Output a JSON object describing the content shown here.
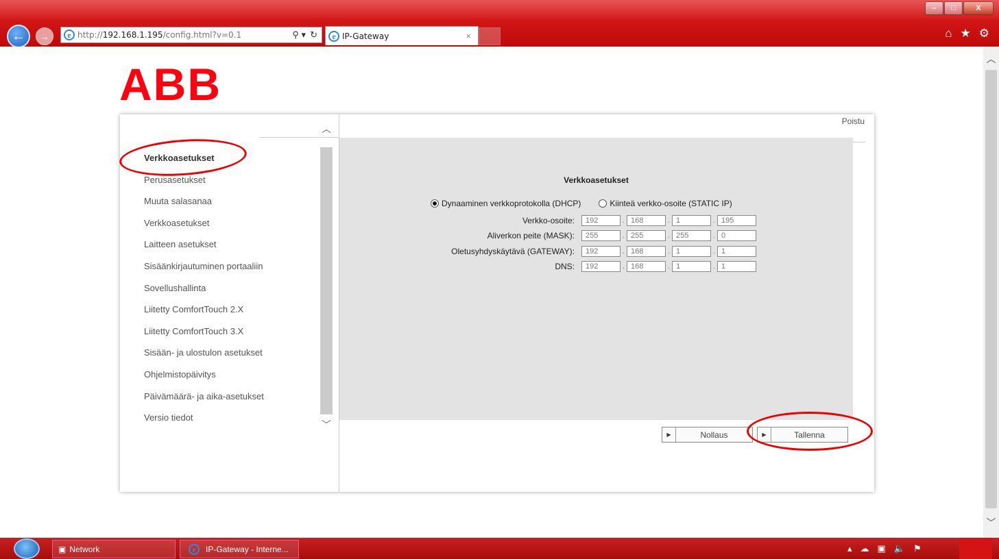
{
  "browser": {
    "url_prefix": "http://",
    "url_host": "192.168.1.195",
    "url_path": "/config.html?v=0.1",
    "tab_title": "IP-Gateway",
    "tab_close": "×",
    "search_glyph": "⚲ ▾",
    "refresh_glyph": "↻",
    "back_glyph": "←",
    "forward_glyph": "→",
    "home_glyph": "⌂",
    "favorites_glyph": "★",
    "tools_glyph": "⚙",
    "window_buttons": [
      "–",
      "□",
      "X"
    ]
  },
  "page": {
    "logo": "ABB",
    "logout": "Poistu",
    "menu": [
      {
        "label": "Verkkoasetukset",
        "active": true
      },
      {
        "label": "Perusasetukset",
        "active": false
      },
      {
        "label": "Muuta salasanaa",
        "active": false
      },
      {
        "label": "Verkkoasetukset",
        "active": false
      },
      {
        "label": "Laitteen asetukset",
        "active": false
      },
      {
        "label": "Sisäänkirjautuminen portaaliin",
        "active": false
      },
      {
        "label": "Sovellushallinta",
        "active": false
      },
      {
        "label": "Liitetty ComfortTouch 2.X",
        "active": false
      },
      {
        "label": "Liitetty ComfortTouch 3.X",
        "active": false
      },
      {
        "label": "Sisään- ja ulostulon asetukset",
        "active": false
      },
      {
        "label": "Ohjelmistopäivitys",
        "active": false
      },
      {
        "label": "Päivämäärä- ja aika-asetukset",
        "active": false
      },
      {
        "label": "Versio tiedot",
        "active": false
      }
    ],
    "form": {
      "title": "Verkkoasetukset",
      "radio_dhcp": "Dynaaminen verkkoprotokolla (DHCP)",
      "radio_static": "Kiinteä verkko-osoite (STATIC IP)",
      "selected_mode": "DHCP",
      "rows": [
        {
          "label": "Verkko-osoite:",
          "octets": [
            "192",
            "168",
            "1",
            "195"
          ]
        },
        {
          "label": "Aliverkon peite (MASK):",
          "octets": [
            "255",
            "255",
            "255",
            "0"
          ]
        },
        {
          "label": "Oletusyhdyskäytävä (GATEWAY):",
          "octets": [
            "192",
            "168",
            "1",
            "1"
          ]
        },
        {
          "label": "DNS:",
          "octets": [
            "192",
            "168",
            "1",
            "1"
          ]
        }
      ],
      "octet_separator": ".",
      "reset_label": "Nollaus",
      "save_label": "Tallenna",
      "button_arrow": "▶"
    }
  },
  "taskbar": {
    "items": [
      "Network",
      "IP-Gateway - Interne..."
    ],
    "tray_icons": [
      "▴",
      "☁",
      "▣",
      "🔈",
      "⚑"
    ]
  },
  "colors": {
    "brand_red": "#ff000f",
    "chrome_red": "#c00a0a",
    "annotation_red": "#ee0000",
    "content_gray": "#e3e3e3"
  }
}
